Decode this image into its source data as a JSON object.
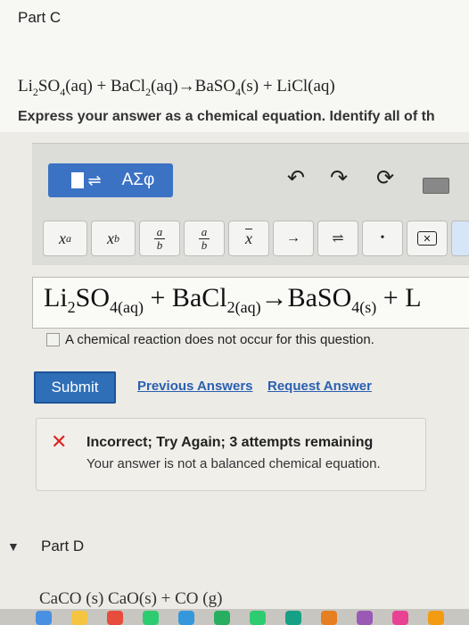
{
  "part_c": {
    "title": "Part C",
    "equation": {
      "r1_a": "Li",
      "r1_a_sub": "2",
      "r1_b": "SO",
      "r1_b_sub": "4",
      "r1_state": "(aq) + BaCl",
      "r2_sub": "2",
      "r2_state": "(aq)→BaSO",
      "p1_sub": "4",
      "p1_state": "(s) + LiCl(aq)"
    },
    "instruction": "Express your answer as a chemical equation. Identify all of th"
  },
  "toolbar": {
    "templates_label": "⬚⇌",
    "greek_label": "ΑΣφ",
    "undo_icon": "undo-icon",
    "redo_icon": "redo-icon",
    "reset_icon": "reset-icon",
    "keyboard_icon": "keyboard-icon",
    "keys": {
      "superscript": "x",
      "superscript_sup": "a",
      "subscript": "x",
      "subscript_sub": "b",
      "frac_num": "a",
      "frac_den": "b",
      "frac2_num": "a",
      "frac2_den": "b",
      "vector": "x",
      "arrow": "→",
      "equilibrium": "⇌",
      "dot": "•",
      "delete": "✕"
    }
  },
  "answer": {
    "t1": "Li",
    "t1_sub": "2",
    "t2": "SO",
    "t2_sub": "4(aq)",
    "t3": " + BaCl",
    "t3_sub": "2(aq)",
    "t4": "→BaSO",
    "t4_sub": "4(s)",
    "t5": " + L"
  },
  "no_reaction_label": "A chemical reaction does not occur for this question.",
  "actions": {
    "submit": "Submit",
    "previous_answers": "Previous Answers",
    "request_answer": "Request Answer"
  },
  "feedback": {
    "title": "Incorrect; Try Again; 3 attempts remaining",
    "message": "Your answer is not a balanced chemical equation."
  },
  "part_d": {
    "title": "Part D",
    "partial_equation": "CaCO (s)  CaO(s) + CO (g)"
  }
}
